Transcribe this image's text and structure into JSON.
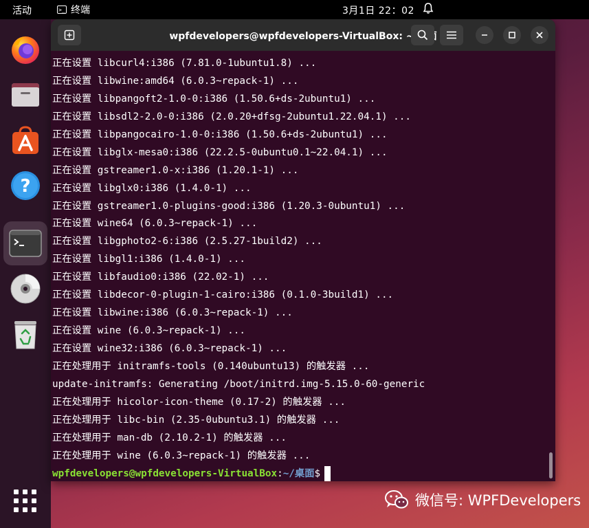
{
  "topbar": {
    "activities": "活动",
    "app_name": "终端",
    "clock": "3月1日  22：02"
  },
  "dock": {
    "items": [
      "firefox-icon",
      "files-icon",
      "software-icon",
      "help-icon",
      "terminal-icon",
      "disc-icon",
      "trash-icon"
    ]
  },
  "window": {
    "title": "wpfdevelopers@wpfdevelopers-VirtualBox: ~/桌面"
  },
  "terminal": {
    "lines": [
      "正在设置 libcurl4:i386 (7.81.0-1ubuntu1.8) ...",
      "正在设置 libwine:amd64 (6.0.3~repack-1) ...",
      "正在设置 libpangoft2-1.0-0:i386 (1.50.6+ds-2ubuntu1) ...",
      "正在设置 libsdl2-2.0-0:i386 (2.0.20+dfsg-2ubuntu1.22.04.1) ...",
      "正在设置 libpangocairo-1.0-0:i386 (1.50.6+ds-2ubuntu1) ...",
      "正在设置 libglx-mesa0:i386 (22.2.5-0ubuntu0.1~22.04.1) ...",
      "正在设置 gstreamer1.0-x:i386 (1.20.1-1) ...",
      "正在设置 libglx0:i386 (1.4.0-1) ...",
      "正在设置 gstreamer1.0-plugins-good:i386 (1.20.3-0ubuntu1) ...",
      "正在设置 wine64 (6.0.3~repack-1) ...",
      "正在设置 libgphoto2-6:i386 (2.5.27-1build2) ...",
      "正在设置 libgl1:i386 (1.4.0-1) ...",
      "正在设置 libfaudio0:i386 (22.02-1) ...",
      "正在设置 libdecor-0-plugin-1-cairo:i386 (0.1.0-3build1) ...",
      "正在设置 libwine:i386 (6.0.3~repack-1) ...",
      "正在设置 wine (6.0.3~repack-1) ...",
      "正在设置 wine32:i386 (6.0.3~repack-1) ...",
      "正在处理用于 initramfs-tools (0.140ubuntu13) 的触发器 ...",
      "update-initramfs: Generating /boot/initrd.img-5.15.0-60-generic",
      "正在处理用于 hicolor-icon-theme (0.17-2) 的触发器 ...",
      "正在处理用于 libc-bin (2.35-0ubuntu3.1) 的触发器 ...",
      "正在处理用于 man-db (2.10.2-1) 的触发器 ...",
      "正在处理用于 wine (6.0.3~repack-1) 的触发器 ..."
    ],
    "prompt_user": "wpfdevelopers@wpfdevelopers-VirtualBox",
    "prompt_sep": ":",
    "prompt_path": "~/桌面",
    "prompt_symbol": "$"
  },
  "watermark": {
    "text": "微信号: WPFDevelopers"
  }
}
